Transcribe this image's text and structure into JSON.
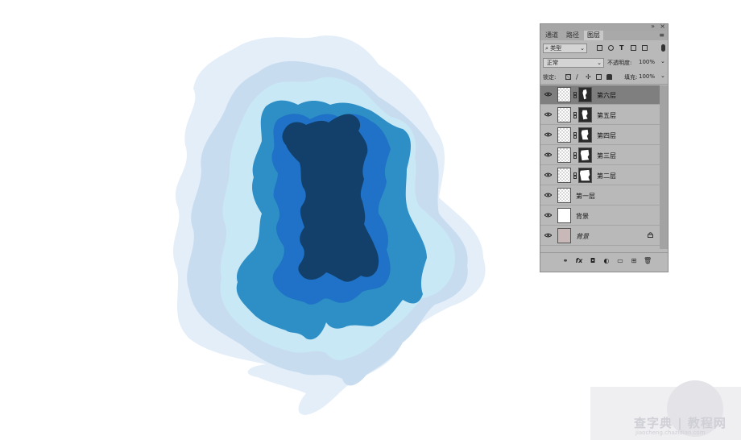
{
  "artwork": {
    "colors": [
      "#e3eef9",
      "#c8dcf0",
      "#c8e8f6",
      "#2d8fc5",
      "#1f72c7",
      "#12406b"
    ]
  },
  "panel": {
    "tabs": [
      "通道",
      "路径",
      "图层"
    ],
    "active_tab": "图层",
    "filter": {
      "label": "类型",
      "icons": [
        "image-filter-icon",
        "adjustment-filter-icon",
        "type-filter-icon",
        "shape-filter-icon",
        "smart-object-filter-icon"
      ]
    },
    "blend_mode": "正常",
    "opacity_label": "不透明度:",
    "opacity_value": "100%",
    "lock_label": "锁定:",
    "lock_icons": [
      "lock-transparent-icon",
      "lock-paint-icon",
      "lock-move-icon",
      "lock-artboard-icon",
      "lock-all-icon"
    ],
    "fill_label": "填充:",
    "fill_value": "100%",
    "layers": [
      {
        "name": "第六层",
        "thumb": "checker",
        "mask": true,
        "selected": true
      },
      {
        "name": "第五层",
        "thumb": "checker",
        "mask": true,
        "selected": false
      },
      {
        "name": "第四层",
        "thumb": "checker",
        "mask": true,
        "selected": false
      },
      {
        "name": "第三层",
        "thumb": "checker",
        "mask": true,
        "selected": false
      },
      {
        "name": "第二层",
        "thumb": "checker",
        "mask": true,
        "selected": false
      },
      {
        "name": "第一层",
        "thumb": "checker",
        "mask": false,
        "selected": false
      },
      {
        "name": "背景",
        "thumb": "white",
        "mask": false,
        "selected": false
      },
      {
        "name": "背景",
        "thumb": "photo",
        "mask": false,
        "selected": false,
        "italic": true,
        "locked": true
      }
    ],
    "bottom_icons": [
      "link-icon",
      "fx-icon",
      "mask-icon",
      "adjustment-icon",
      "folder-icon",
      "new-layer-icon",
      "trash-icon"
    ],
    "bottom_fx_label": "fx"
  },
  "watermark": {
    "main": "查字典 | 教程网",
    "sub": "jiaocheng.chazidian.com"
  }
}
